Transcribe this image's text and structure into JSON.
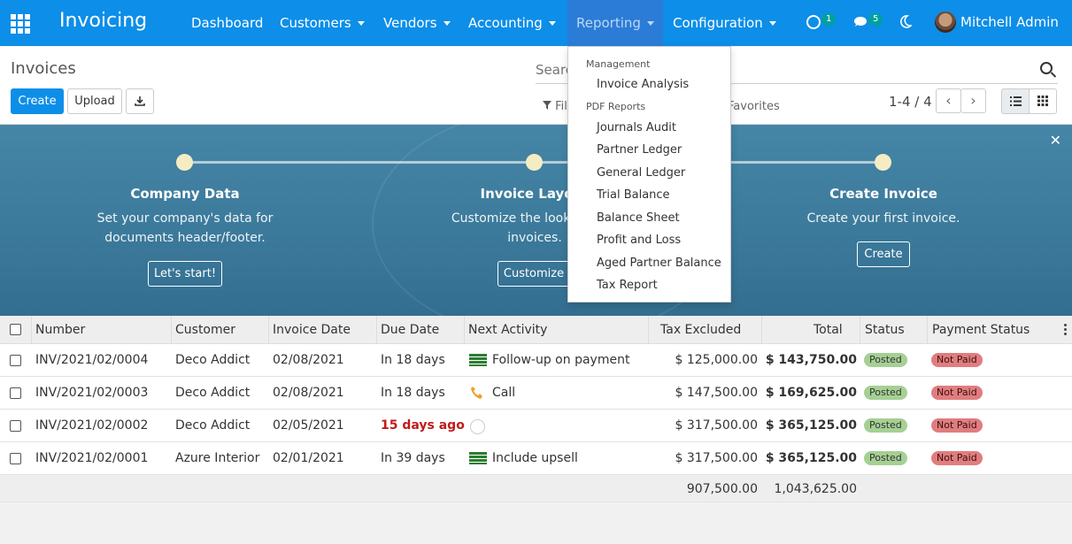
{
  "navbar": {
    "app_name": "Invoicing",
    "menu": [
      "Dashboard",
      "Customers",
      "Vendors",
      "Accounting",
      "Reporting",
      "Configuration"
    ],
    "activity_count": "1",
    "message_count": "5",
    "user_name": "Mitchell Admin"
  },
  "control_panel": {
    "title": "Invoices",
    "create_label": "Create",
    "upload_label": "Upload",
    "search_placeholder": "Search...",
    "filters_label": "Filters",
    "favorites_label": "Favorites",
    "pager": "1-4 / 4"
  },
  "reporting_menu": {
    "management_header": "Management",
    "management_items": [
      "Invoice Analysis"
    ],
    "pdf_header": "PDF Reports",
    "pdf_items": [
      "Journals Audit",
      "Partner Ledger",
      "General Ledger",
      "Trial Balance",
      "Balance Sheet",
      "Profit and Loss",
      "Aged Partner Balance",
      "Tax Report"
    ]
  },
  "onboarding": {
    "steps": [
      {
        "title": "Company Data",
        "desc1": "Set your company's data for",
        "desc2": "documents header/footer.",
        "button": "Let's start!"
      },
      {
        "title": "Invoice Layout",
        "desc1": "Customize the look of your",
        "desc2": "invoices.",
        "button": "Customize"
      },
      {
        "title": "Create Invoice",
        "desc1": "Create your first invoice.",
        "desc2": "",
        "button": "Create"
      }
    ]
  },
  "table": {
    "headers": [
      "Number",
      "Customer",
      "Invoice Date",
      "Due Date",
      "Next Activity",
      "Tax Excluded",
      "Total",
      "Status",
      "Payment Status"
    ],
    "rows": [
      {
        "number": "INV/2021/02/0004",
        "customer": "Deco Addict",
        "invoice_date": "02/08/2021",
        "due": "In 18 days",
        "activity": "Follow-up on payment",
        "tax_excl": "$ 125,000.00",
        "total": "$ 143,750.00",
        "status": "Posted",
        "payment": "Not Paid"
      },
      {
        "number": "INV/2021/02/0003",
        "customer": "Deco Addict",
        "invoice_date": "02/08/2021",
        "due": "In 18 days",
        "activity": "Call",
        "tax_excl": "$ 147,500.00",
        "total": "$ 169,625.00",
        "status": "Posted",
        "payment": "Not Paid"
      },
      {
        "number": "INV/2021/02/0002",
        "customer": "Deco Addict",
        "invoice_date": "02/05/2021",
        "due": "15 days ago",
        "activity": "",
        "tax_excl": "$ 317,500.00",
        "total": "$ 365,125.00",
        "status": "Posted",
        "payment": "Not Paid"
      },
      {
        "number": "INV/2021/02/0001",
        "customer": "Azure Interior",
        "invoice_date": "02/01/2021",
        "due": "In 39 days",
        "activity": "Include upsell",
        "tax_excl": "$ 317,500.00",
        "total": "$ 365,125.00",
        "status": "Posted",
        "payment": "Not Paid"
      }
    ],
    "footer_tax_excl": "907,500.00",
    "footer_total": "1,043,625.00"
  },
  "colors": {
    "brand": "#0d8ee8",
    "posted": "#a5d094",
    "not_paid": "#e07d7f",
    "late": "#c11a1a"
  }
}
